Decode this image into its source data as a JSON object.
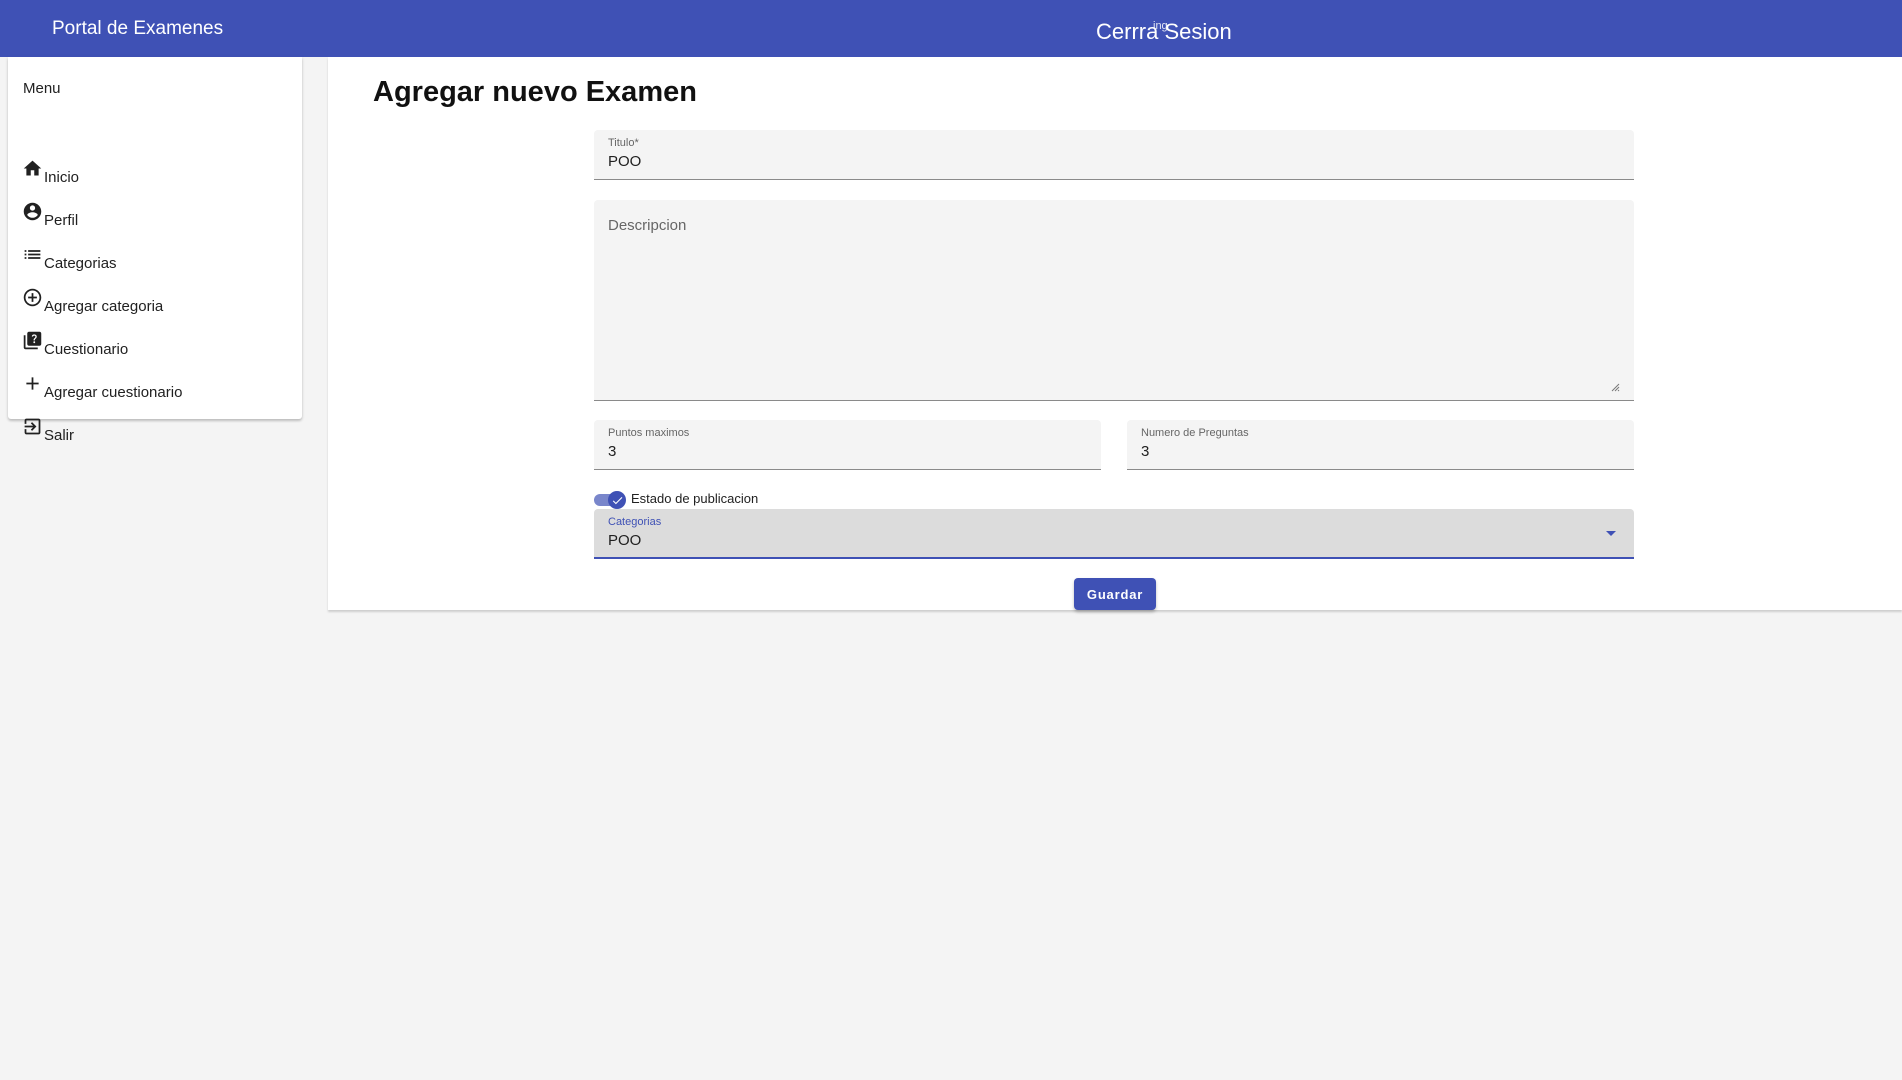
{
  "header": {
    "brand": "Portal de Examenes",
    "logout_label": "Cerrra Sesion",
    "overlap_text": "ing"
  },
  "sidebar": {
    "title": "Menu",
    "items": [
      {
        "label": "Inicio",
        "icon": "home-icon"
      },
      {
        "label": "Perfil",
        "icon": "account-circle-icon"
      },
      {
        "label": "Categorias",
        "icon": "list-icon"
      },
      {
        "label": "Agregar categoria",
        "icon": "add-circle-icon"
      },
      {
        "label": "Cuestionario",
        "icon": "quiz-icon"
      },
      {
        "label": "Agregar cuestionario",
        "icon": "plus-icon"
      },
      {
        "label": "Salir",
        "icon": "logout-icon"
      }
    ]
  },
  "form": {
    "page_title": "Agregar nuevo Examen",
    "titulo": {
      "label": "Titulo*",
      "value": "POO"
    },
    "descripcion": {
      "placeholder": "Descripcion",
      "value": ""
    },
    "puntos": {
      "label": "Puntos maximos",
      "value": "3"
    },
    "preguntas": {
      "label": "Numero de Preguntas",
      "value": "3"
    },
    "estado": {
      "label": "Estado de publicacion",
      "checked": true
    },
    "categoria": {
      "label": "Categorias",
      "value": "POO"
    },
    "save_label": "Guardar"
  },
  "colors": {
    "primary": "#3f51b5",
    "primary_light": "#7986cb",
    "background": "#f4f4f4"
  }
}
